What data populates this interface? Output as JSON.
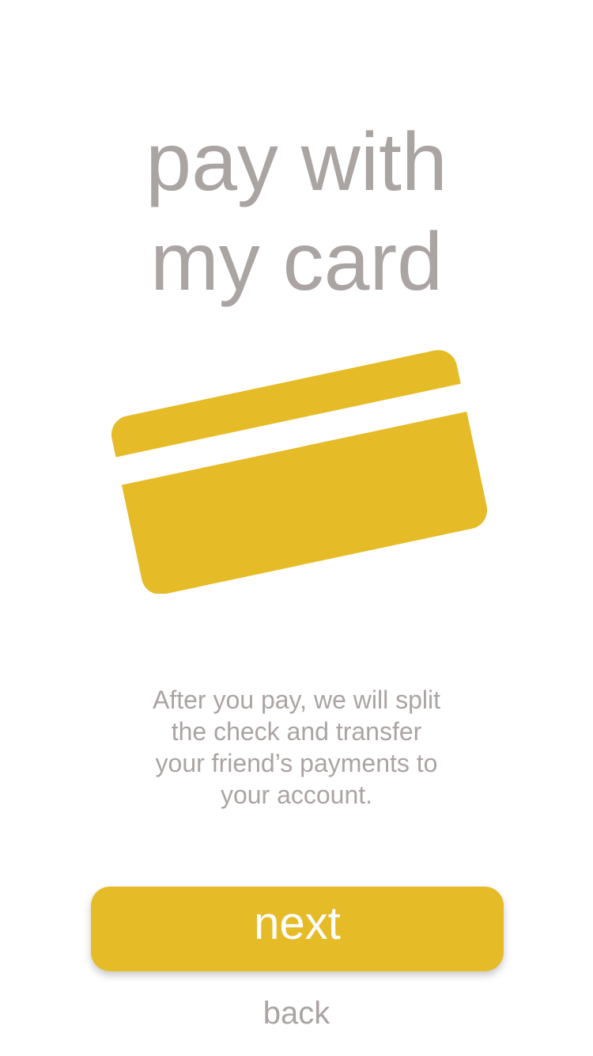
{
  "title": {
    "line1": "pay with",
    "line2": "my card"
  },
  "illustration": {
    "icon": "credit-card-icon",
    "color": "#e6bb28"
  },
  "description": "After you pay, we will split the check and transfer your friend’s payments to your account.",
  "actions": {
    "next_label": "next",
    "back_label": "back"
  },
  "colors": {
    "accent": "#e6bb28",
    "text_muted": "#aaa4a2",
    "button_text": "#ffffff"
  }
}
